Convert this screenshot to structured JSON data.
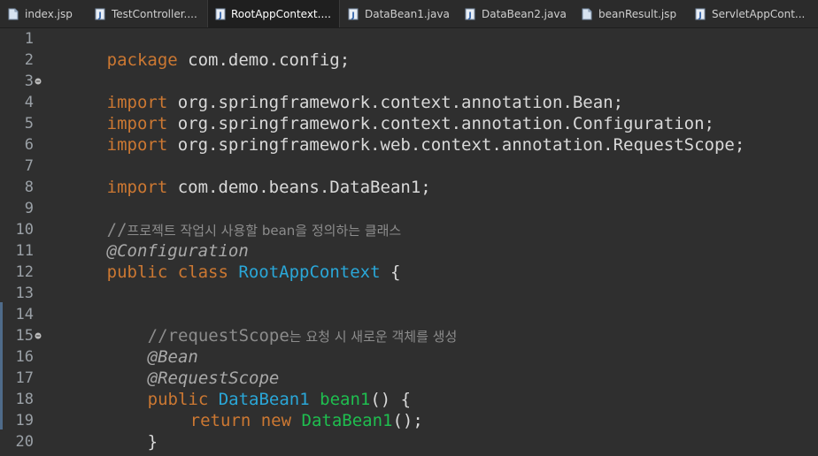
{
  "tabs": [
    {
      "label": "index.jsp",
      "icon": "jsp-file-icon",
      "active": false
    },
    {
      "label": "TestController....",
      "icon": "java-file-icon",
      "active": false
    },
    {
      "label": "RootAppContext....",
      "icon": "java-file-icon",
      "active": true,
      "close": "×"
    },
    {
      "label": "DataBean1.java",
      "icon": "java-file-icon",
      "active": false
    },
    {
      "label": "DataBean2.java",
      "icon": "java-file-icon",
      "active": false
    },
    {
      "label": "beanResult.jsp",
      "icon": "jsp-file-icon",
      "active": false
    },
    {
      "label": "ServletAppCont...",
      "icon": "java-file-icon",
      "active": false
    }
  ],
  "editor": {
    "line_numbers": [
      "1",
      "2",
      "3",
      "4",
      "5",
      "6",
      "7",
      "8",
      "9",
      "10",
      "11",
      "12",
      "13",
      "14",
      "15",
      "16",
      "17",
      "18",
      "19",
      "20"
    ],
    "lines": {
      "l1": {
        "kw": "package",
        "rest": " com.demo.config;"
      },
      "l3": {
        "kw": "import",
        "rest": " org.springframework.context.annotation.Bean;"
      },
      "l4": {
        "kw": "import",
        "rest": " org.springframework.context.annotation.Configuration;"
      },
      "l5": {
        "kw": "import",
        "rest": " org.springframework.web.context.annotation.RequestScope;"
      },
      "l7": {
        "kw": "import",
        "rest": " com.demo.beans.DataBean1;"
      },
      "l9": {
        "prefix": "//",
        "text": "프로젝트 작업시 사용할 bean을 정의하는 클래스"
      },
      "l10": {
        "ann": "@Configuration"
      },
      "l11": {
        "kw1": "public",
        "kw2": "class",
        "cls": "RootAppContext",
        "brace": "{"
      },
      "l14": {
        "prefix": "//requestScope",
        "text": "는 요청 시 새로운 객체를 생성"
      },
      "l15": {
        "ann": "@Bean"
      },
      "l16": {
        "ann": "@RequestScope"
      },
      "l17": {
        "kw": "public",
        "cls": "DataBean1",
        "method": "bean1",
        "rest": "() {"
      },
      "l18": {
        "kw1": "return",
        "kw2": "new",
        "cls": "DataBean1",
        "rest": "();"
      },
      "l19": {
        "brace": "}"
      },
      "l20": {
        "brace": "}"
      }
    }
  },
  "colors": {
    "keyword": "#cc7832",
    "class": "#2aa7d8",
    "method": "#1fbe4f",
    "annotation": "#a9a9a9",
    "comment": "#8c8c8c",
    "background": "#2f2f2f"
  }
}
